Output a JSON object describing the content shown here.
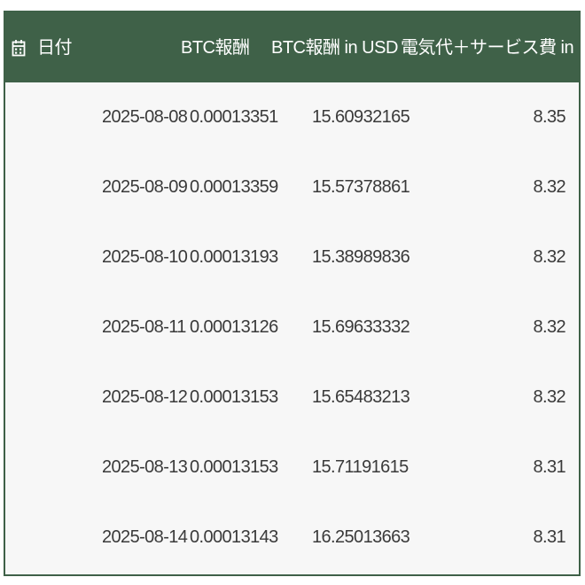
{
  "colors": {
    "header_bg": "#3f6148",
    "body_bg": "#f7f7f7",
    "text": "#3a3a3a",
    "header_text": "#ffffff"
  },
  "header": {
    "icon": "calendar-icon",
    "date_label": "日付",
    "btc_label": "BTC報酬",
    "btc_usd_label": "BTC報酬 in USD",
    "fee_label": "電気代＋サービス費 in USD"
  },
  "rows": [
    {
      "date": "2025-08-08",
      "btc": "0.00013351",
      "usd": "15.60932165",
      "fee": "8.35"
    },
    {
      "date": "2025-08-09",
      "btc": "0.00013359",
      "usd": "15.57378861",
      "fee": "8.32"
    },
    {
      "date": "2025-08-10",
      "btc": "0.00013193",
      "usd": "15.38989836",
      "fee": "8.32"
    },
    {
      "date": "2025-08-11",
      "btc": "0.00013126",
      "usd": "15.69633332",
      "fee": "8.32"
    },
    {
      "date": "2025-08-12",
      "btc": "0.00013153",
      "usd": "15.65483213",
      "fee": "8.32"
    },
    {
      "date": "2025-08-13",
      "btc": "0.00013153",
      "usd": "15.71191615",
      "fee": "8.31"
    },
    {
      "date": "2025-08-14",
      "btc": "0.00013143",
      "usd": "16.25013663",
      "fee": "8.31"
    }
  ]
}
